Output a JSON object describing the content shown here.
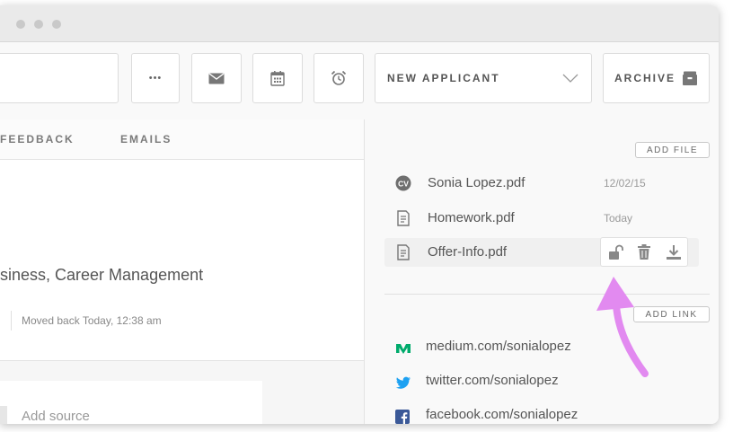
{
  "toolbar": {
    "more_label": "•••",
    "stage_select": "NEW APPLICANT",
    "archive_label": "ARCHIVE"
  },
  "tabs": [
    {
      "label": "FEEDBACK"
    },
    {
      "label": "EMAILS"
    }
  ],
  "main": {
    "tags_text": "siness, Career Management",
    "status_text": "Moved back Today, 12:38 am",
    "source_placeholder": "Add source"
  },
  "files": {
    "add_label": "ADD FILE",
    "items": [
      {
        "name": "Sonia Lopez.pdf",
        "date": "12/02/15",
        "icon": "cv-icon"
      },
      {
        "name": "Homework.pdf",
        "date": "Today",
        "icon": "document-icon"
      },
      {
        "name": "Offer-Info.pdf",
        "date": "",
        "icon": "document-icon"
      }
    ],
    "actions": [
      "unlock-icon",
      "trash-icon",
      "download-icon"
    ]
  },
  "links": {
    "add_label": "ADD LINK",
    "items": [
      {
        "text": "medium.com/sonialopez",
        "icon": "medium-icon",
        "color": "#00ab6c"
      },
      {
        "text": "twitter.com/sonialopez",
        "icon": "twitter-icon",
        "color": "#1da1f2"
      },
      {
        "text": "facebook.com/sonialopez",
        "icon": "facebook-icon",
        "color": "#3b5998"
      }
    ]
  },
  "colors": {
    "annotation_arrow": "#e28af0"
  }
}
